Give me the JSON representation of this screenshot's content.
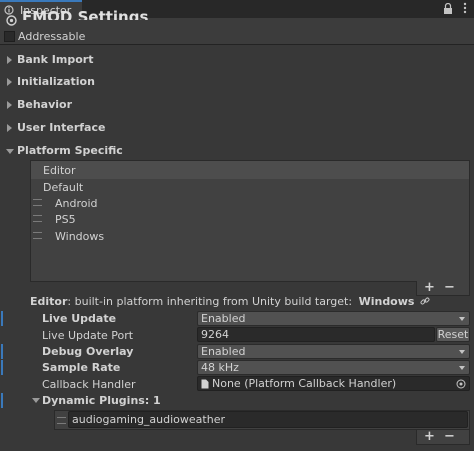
{
  "tab": {
    "label": "Inspector"
  },
  "header": {
    "title": "FMOD Settings",
    "addressable_label": "Addressable"
  },
  "sections": [
    {
      "label": "Bank Import"
    },
    {
      "label": "Initialization"
    },
    {
      "label": "Behavior"
    },
    {
      "label": "User Interface"
    },
    {
      "label": "Platform Specific"
    }
  ],
  "platforms": [
    "Editor",
    "Default",
    "Android",
    "PS5",
    "Windows"
  ],
  "list_buttons": {
    "add": "+",
    "remove": "−"
  },
  "editor_info": {
    "prefix": "Editor",
    "text": ": built-in platform inheriting from Unity build target:",
    "target": "Windows"
  },
  "settings": {
    "live_update": {
      "label": "Live Update",
      "value": "Enabled"
    },
    "live_update_port": {
      "label": "Live Update Port",
      "value": "9264",
      "reset": "Reset"
    },
    "debug_overlay": {
      "label": "Debug Overlay",
      "value": "Enabled"
    },
    "sample_rate": {
      "label": "Sample Rate",
      "value": "48 kHz"
    },
    "callback_handler": {
      "label": "Callback Handler",
      "value": "None (Platform Callback Handler)"
    },
    "dynamic_plugins": {
      "label": "Dynamic Plugins: 1",
      "items": [
        "audiogaming_audioweather"
      ]
    }
  },
  "colors": {
    "accent": "#3a79bb",
    "background": "#383838"
  },
  "icons": [
    "fmod-logo-icon",
    "lock-icon",
    "more-icon",
    "link-icon",
    "object-icon",
    "target-icon"
  ]
}
